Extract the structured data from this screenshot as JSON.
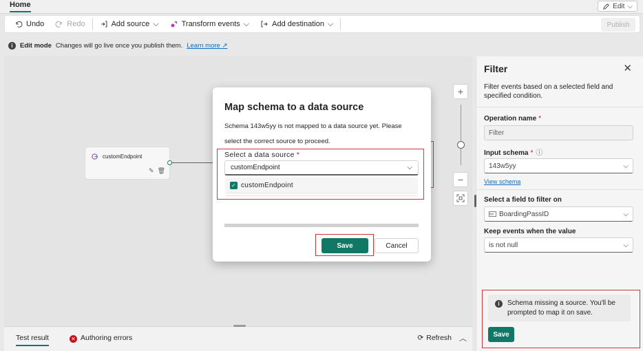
{
  "topbar": {
    "home_tab": "Home",
    "edit_label": "Edit"
  },
  "toolbar": {
    "undo": "Undo",
    "redo": "Redo",
    "add_source": "Add source",
    "transform_events": "Transform events",
    "add_destination": "Add destination",
    "publish": "Publish"
  },
  "editbar": {
    "mode": "Edit mode",
    "message": "Changes will go live once you publish them.",
    "learn_more": "Learn more"
  },
  "canvas": {
    "node_label": "customEndpoint"
  },
  "modal": {
    "title": "Map schema to a data source",
    "description": "Schema 143w5yy is not mapped to a data source yet. Please select the correct source to proceed.",
    "select_label": "Select a data source",
    "required_marker": "*",
    "selected_value": "customEndpoint",
    "option_label": "customEndpoint",
    "save": "Save",
    "cancel": "Cancel"
  },
  "bottom": {
    "tab_test_result": "Test result",
    "tab_authoring_errors": "Authoring errors",
    "refresh": "Refresh"
  },
  "panel": {
    "title": "Filter",
    "description": "Filter events based on a selected field and specified condition.",
    "operation_name_label": "Operation name",
    "operation_name_value": "Filter",
    "input_schema_label": "Input schema",
    "input_schema_value": "143w5yy",
    "view_schema": "View schema",
    "field_label": "Select a field to filter on",
    "field_value": "BoardingPassID",
    "keep_label": "Keep events when the value",
    "keep_value": "is not null",
    "warning": "Schema missing a source. You'll be prompted to map it on save.",
    "save": "Save",
    "required_marker": "*"
  },
  "colors": {
    "accent": "#117865",
    "error": "#d13438",
    "link": "#0f6cbd"
  }
}
